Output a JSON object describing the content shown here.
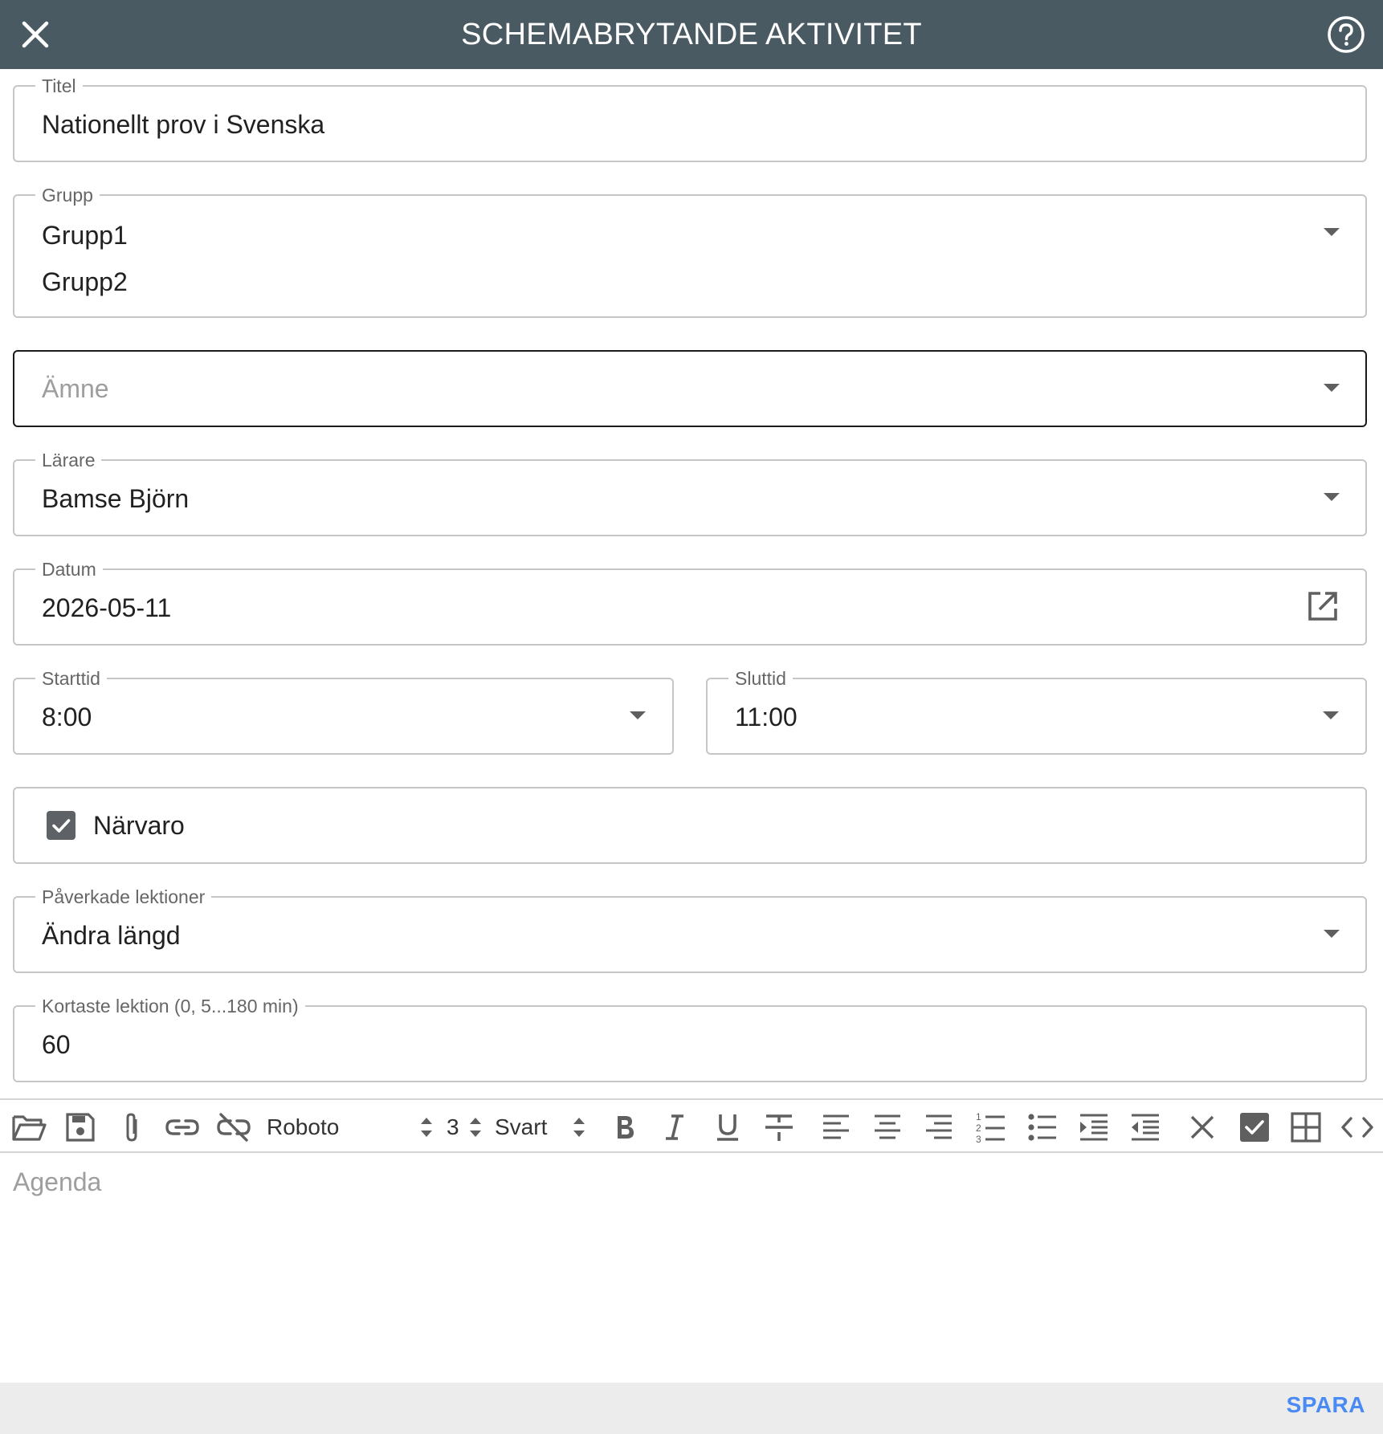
{
  "header": {
    "title": "SCHEMABRYTANDE AKTIVITET",
    "close_icon": "close-icon",
    "help_icon": "help-circle-icon",
    "background": "#4a5a63"
  },
  "form": {
    "titel": {
      "label": "Titel",
      "value": "Nationellt prov i Svenska"
    },
    "grupp": {
      "label": "Grupp",
      "values": [
        "Grupp1",
        "Grupp2"
      ]
    },
    "amne": {
      "placeholder": "Ämne"
    },
    "larare": {
      "label": "Lärare",
      "value": "Bamse Björn"
    },
    "datum": {
      "label": "Datum",
      "value": "2026-05-11",
      "icon": "open-in-new-icon"
    },
    "starttid": {
      "label": "Starttid",
      "value": "8:00"
    },
    "sluttid": {
      "label": "Sluttid",
      "value": "11:00"
    },
    "narvaro": {
      "label": "Närvaro",
      "checked": true
    },
    "paverkade": {
      "label": "Påverkade lektioner",
      "value": "Ändra längd"
    },
    "kortaste": {
      "label": "Kortaste lektion (0, 5...180 min)",
      "value": "60"
    }
  },
  "toolbar": {
    "font": "Roboto",
    "size": "3",
    "color": "Svart",
    "icons": [
      "open-folder-icon",
      "save-disk-icon",
      "attachment-icon",
      "link-icon",
      "unlink-icon",
      "bold-icon",
      "italic-icon",
      "underline-icon",
      "strikethrough-icon",
      "align-left-icon",
      "align-center-icon",
      "align-right-icon",
      "ordered-list-icon",
      "unordered-list-icon",
      "indent-icon",
      "outdent-icon",
      "clear-format-icon",
      "checkbox-icon",
      "table-icon",
      "code-icon"
    ]
  },
  "agenda": {
    "placeholder": "Agenda"
  },
  "footer": {
    "save_label": "SPARA",
    "accent": "#4a8af4"
  }
}
